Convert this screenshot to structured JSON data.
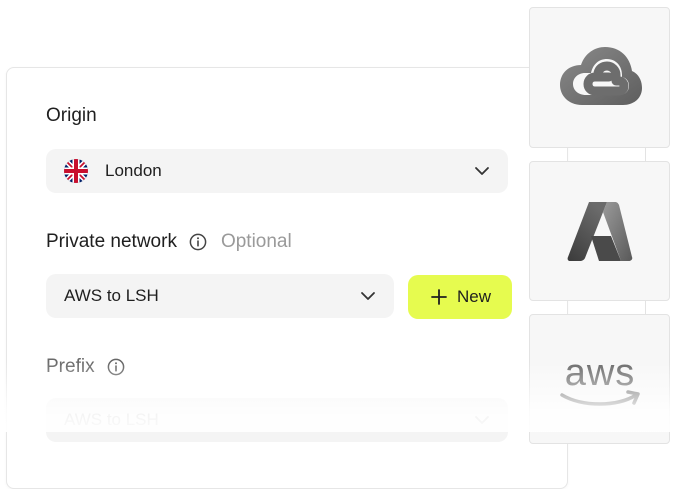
{
  "origin": {
    "title": "Origin",
    "selected": "London",
    "flag": "uk-flag-icon"
  },
  "network": {
    "title": "Private network",
    "optional_label": "Optional",
    "selected": "AWS to LSH",
    "new_button_label": "New"
  },
  "prefix": {
    "title": "Prefix",
    "selected": "AWS to LSH"
  },
  "providers": {
    "gcp_icon": "google-cloud-icon",
    "azure_icon": "azure-icon",
    "aws_icon": "aws-icon"
  },
  "colors": {
    "accent": "#e6fb4f",
    "field_bg": "#f4f4f4",
    "muted_text": "#9a9a9a"
  }
}
